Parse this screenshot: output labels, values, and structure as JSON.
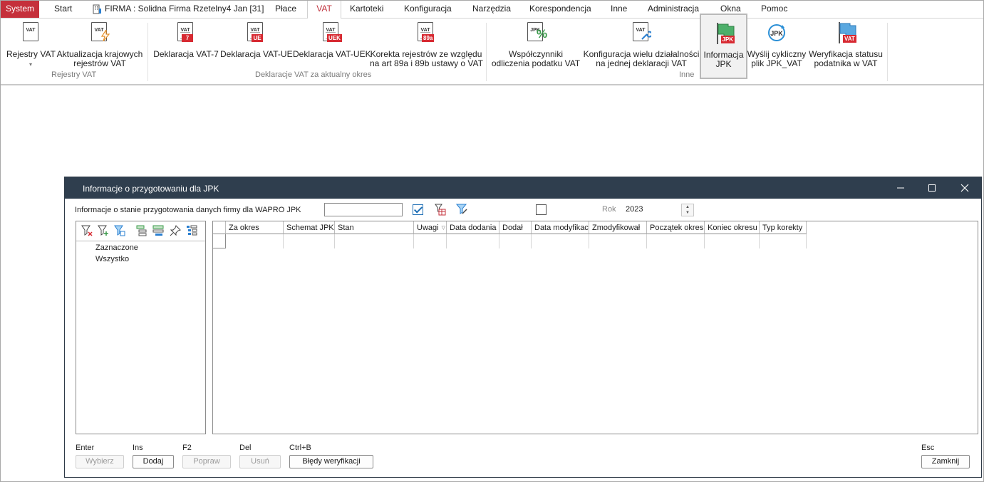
{
  "menubar": {
    "items": [
      "System",
      "Start",
      "FIRMA : Solidna Firma Rzetelny4 Jan [31]",
      "Płace",
      "VAT",
      "Kartoteki",
      "Konfiguracja",
      "Narzędzia",
      "Korespondencja",
      "Inne",
      "Administracja",
      "Okna",
      "Pomoc"
    ],
    "active": "VAT",
    "accent": "#c5303b"
  },
  "ribbon": {
    "groups": {
      "rejestry": "Rejestry VAT",
      "deklaracje": "Deklaracje VAT za aktualny okres",
      "inne": "Inne"
    },
    "buttons": {
      "rejestry_vat": {
        "line1": "Rejestry VAT",
        "icon_text": "VAT"
      },
      "aktualizacja": {
        "line1": "Aktualizacja krajowych",
        "line2": "rejestrów VAT",
        "icon_text": "VAT"
      },
      "vat7": {
        "line1": "Deklaracja VAT-7",
        "icon_text": "VAT",
        "tag": "7"
      },
      "vatue": {
        "line1": "Deklaracja VAT-UE",
        "icon_text": "VAT",
        "tag": "UE"
      },
      "vatuek": {
        "line1": "Deklaracja VAT-UEK",
        "icon_text": "VAT",
        "tag": "UEK"
      },
      "korekta": {
        "line1": "Korekta rejestrów ze względu",
        "line2": "na art 89a i 89b ustawy o VAT",
        "icon_text": "VAT",
        "tag": "89a"
      },
      "wspolczynniki": {
        "line1": "Współczynniki",
        "line2": "odliczenia podatku VAT",
        "icon_text": "JPK"
      },
      "konfiguracja": {
        "line1": "Konfiguracja wielu działalności",
        "line2": "na jednej deklaracji VAT",
        "icon_text": "VAT"
      },
      "informacja_jpk": {
        "line1": "Informacja",
        "line2": "JPK",
        "tag": "JPK"
      },
      "wyslij": {
        "line1": "Wyślij cykliczny",
        "line2": "plik JPK_VAT",
        "icon_text": "JPK"
      },
      "weryfikacja": {
        "line1": "Weryfikacja statusu",
        "line2": "podatnika w VAT",
        "tag": "VAT"
      }
    }
  },
  "dialog": {
    "title": "Informacje o przygotowaniu dla JPK",
    "info_label": "Informacje o stanie przygotowania danych firmy dla WAPRO JPK",
    "search_value": "",
    "rok_label": "Rok",
    "rok_value": "2023",
    "tree": [
      "Zaznaczone",
      "Wszystko"
    ],
    "columns": [
      "Za okres",
      "Schemat JPK",
      "Stan",
      "Uwagi",
      "Data dodania",
      "Dodał",
      "Data modyfikac",
      "Zmodyfikował",
      "Początek okres",
      "Koniec okresu",
      "Typ korekty"
    ],
    "hotkeys": {
      "enter": "Enter",
      "ins": "Ins",
      "f2": "F2",
      "del": "Del",
      "ctrlb": "Ctrl+B",
      "esc": "Esc"
    },
    "buttons": {
      "wybierz": "Wybierz",
      "dodaj": "Dodaj",
      "popraw": "Popraw",
      "usun": "Usuń",
      "bledy": "Błędy weryfikacji",
      "zamknij": "Zamknij"
    },
    "titlebar_color": "#2f3e4e"
  }
}
